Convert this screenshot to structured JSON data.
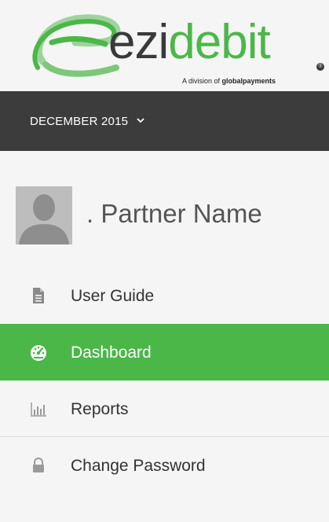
{
  "brand": {
    "logo_prefix": "ezi",
    "logo_suffix": "debit",
    "registered_mark": "®",
    "tagline_prefix": "A division of",
    "tagline_brand": "globalpayments",
    "primary_color": "#4bb748",
    "dark_color": "#3c3c3c"
  },
  "period": {
    "label": "DECEMBER 2015",
    "icon": "chevron-down-icon"
  },
  "profile": {
    "name": ". Partner Name",
    "avatar_icon": "user-silhouette-icon"
  },
  "nav": {
    "items": [
      {
        "label": "User Guide",
        "icon": "document-icon",
        "active": false
      },
      {
        "label": "Dashboard",
        "icon": "dashboard-gauge-icon",
        "active": true
      },
      {
        "label": "Reports",
        "icon": "bar-chart-icon",
        "active": false
      },
      {
        "label": "Change Password",
        "icon": "lock-icon",
        "active": false
      }
    ]
  }
}
